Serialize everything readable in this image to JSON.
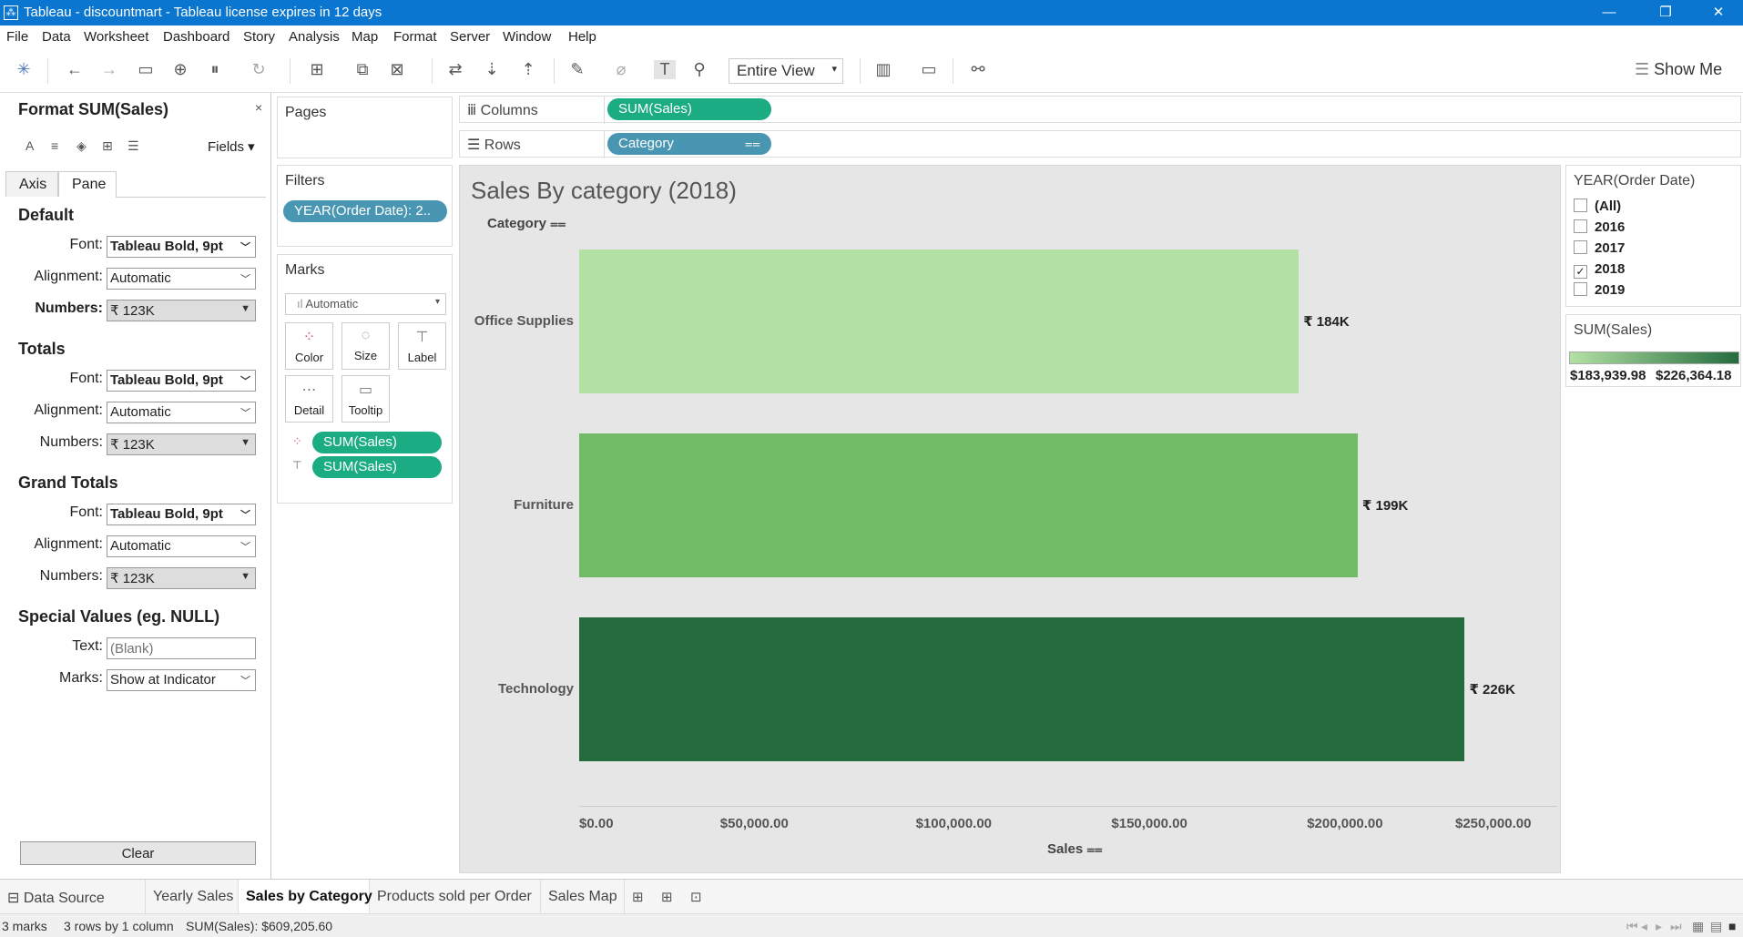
{
  "window": {
    "title": "Tableau - discountmart - Tableau license expires in 12 days",
    "minimize": "—",
    "restore": "❐",
    "close": "✕"
  },
  "menu": [
    "File",
    "Data",
    "Worksheet",
    "Dashboard",
    "Story",
    "Analysis",
    "Map",
    "Format",
    "Server",
    "Window",
    "Help"
  ],
  "toolbar": {
    "fit": "Entire View",
    "show_me": "Show Me",
    "icons": [
      "tableau-logo-icon",
      "undo-icon",
      "redo-icon",
      "save-icon",
      "new-datasource-icon",
      "pause-updates-icon",
      "refresh-icon",
      "new-worksheet-icon",
      "duplicate-icon",
      "clear-sheet-icon",
      "swap-icon",
      "sort-asc-icon",
      "sort-desc-icon",
      "highlight-icon",
      "group-icon",
      "show-labels-icon",
      "fix-axes-icon",
      "fit-icon",
      "show-cards-icon",
      "presentation-icon",
      "share-icon"
    ]
  },
  "format_pane": {
    "title": "Format SUM(Sales)",
    "close": "×",
    "fields": "Fields ▾",
    "tabs": [
      "Axis",
      "Pane"
    ],
    "active_tab": "Pane",
    "sections": {
      "default": {
        "heading": "Default",
        "font_label": "Font:",
        "font_value": "Tableau Bold, 9pt",
        "align_label": "Alignment:",
        "align_value": "Automatic",
        "numbers_label": "Numbers:",
        "numbers_value": "₹ 123K"
      },
      "totals": {
        "heading": "Totals",
        "font_label": "Font:",
        "font_value": "Tableau Bold, 9pt",
        "align_label": "Alignment:",
        "align_value": "Automatic",
        "numbers_label": "Numbers:",
        "numbers_value": "₹ 123K"
      },
      "grand_totals": {
        "heading": "Grand Totals",
        "font_label": "Font:",
        "font_value": "Tableau Bold, 9pt",
        "align_label": "Alignment:",
        "align_value": "Automatic",
        "numbers_label": "Numbers:",
        "numbers_value": "₹ 123K"
      },
      "special": {
        "heading": "Special Values (eg. NULL)",
        "text_label": "Text:",
        "text_placeholder": "(Blank)",
        "marks_label": "Marks:",
        "marks_value": "Show at Indicator"
      }
    },
    "clear": "Clear"
  },
  "cards": {
    "pages": "Pages",
    "filters": "Filters",
    "filter_pill": "YEAR(Order Date): 2..",
    "marks": "Marks",
    "mark_type": "Automatic",
    "mark_buttons": [
      "Color",
      "Size",
      "Label",
      "Detail",
      "Tooltip"
    ],
    "mark_pills": [
      "SUM(Sales)",
      "SUM(Sales)"
    ]
  },
  "shelves": {
    "columns_label": "Columns",
    "columns_pill": "SUM(Sales)",
    "rows_label": "Rows",
    "rows_pill": "Category"
  },
  "viz": {
    "title": "Sales By category (2018)",
    "row_header": "Category ⩵",
    "x_title": "Sales ⩵"
  },
  "chart_data": {
    "type": "bar",
    "orientation": "horizontal",
    "title": "Sales By category (2018)",
    "xlabel": "Sales",
    "ylabel": "Category",
    "categories": [
      "Office Supplies",
      "Furniture",
      "Technology"
    ],
    "values": [
      183939.98,
      199000,
      226364.18
    ],
    "data_labels": [
      "₹ 184K",
      "₹ 199K",
      "₹ 226K"
    ],
    "colors": [
      "#b3e1a4",
      "#72bb66",
      "#246c3e"
    ],
    "xlim": [
      0,
      250000
    ],
    "xticks": [
      0,
      50000,
      100000,
      150000,
      200000,
      250000
    ],
    "xtick_labels": [
      "$0.00",
      "$50,000.00",
      "$100,000.00",
      "$150,000.00",
      "$200,000.00",
      "$250,000.00"
    ],
    "grid": false
  },
  "legends": {
    "year_title": "YEAR(Order Date)",
    "year_items": [
      {
        "label": "(All)",
        "checked": false
      },
      {
        "label": "2016",
        "checked": false
      },
      {
        "label": "2017",
        "checked": false
      },
      {
        "label": "2018",
        "checked": true
      },
      {
        "label": "2019",
        "checked": false
      }
    ],
    "sales_title": "SUM(Sales)",
    "sales_min": "$183,939.98",
    "sales_max": "$226,364.18"
  },
  "sheets": {
    "data_source": "Data Source",
    "tabs": [
      "Yearly Sales",
      "Sales by Category",
      "Products sold per Order",
      "Sales Map"
    ],
    "active": "Sales by Category"
  },
  "status": {
    "marks": "3 marks",
    "rows": "3 rows by 1 column",
    "sum": "SUM(Sales): $609,205.60"
  }
}
